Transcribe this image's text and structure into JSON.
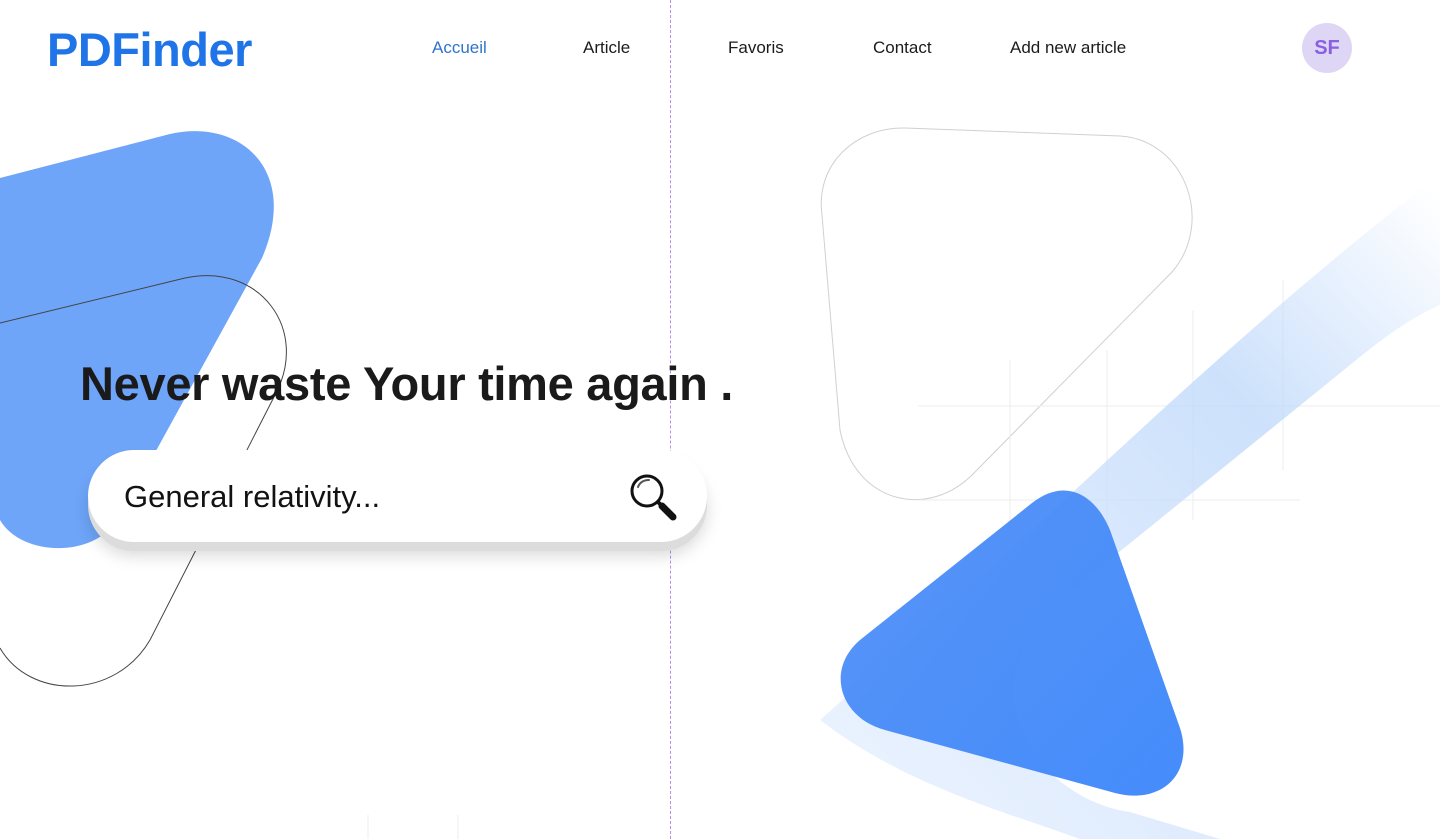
{
  "brand": {
    "name": "PDFinder",
    "color": "#1f74e8"
  },
  "nav": {
    "items": [
      {
        "label": "Accueil",
        "active": true
      },
      {
        "label": "Article",
        "active": false
      },
      {
        "label": "Favoris",
        "active": false
      },
      {
        "label": "Contact",
        "active": false
      },
      {
        "label": "Add new article",
        "active": false
      }
    ]
  },
  "user": {
    "initials": "SF"
  },
  "hero": {
    "title": "Never waste Your time again ."
  },
  "search": {
    "placeholder": "General relativity...",
    "value": "",
    "icon": "magnifier-icon"
  },
  "theme": {
    "accent": "#4f8ff7",
    "nav_active": "#2f74c9",
    "avatar_bg": "#ddd6f5",
    "avatar_text": "#8b5fe2",
    "guide": "#b48ff0"
  }
}
